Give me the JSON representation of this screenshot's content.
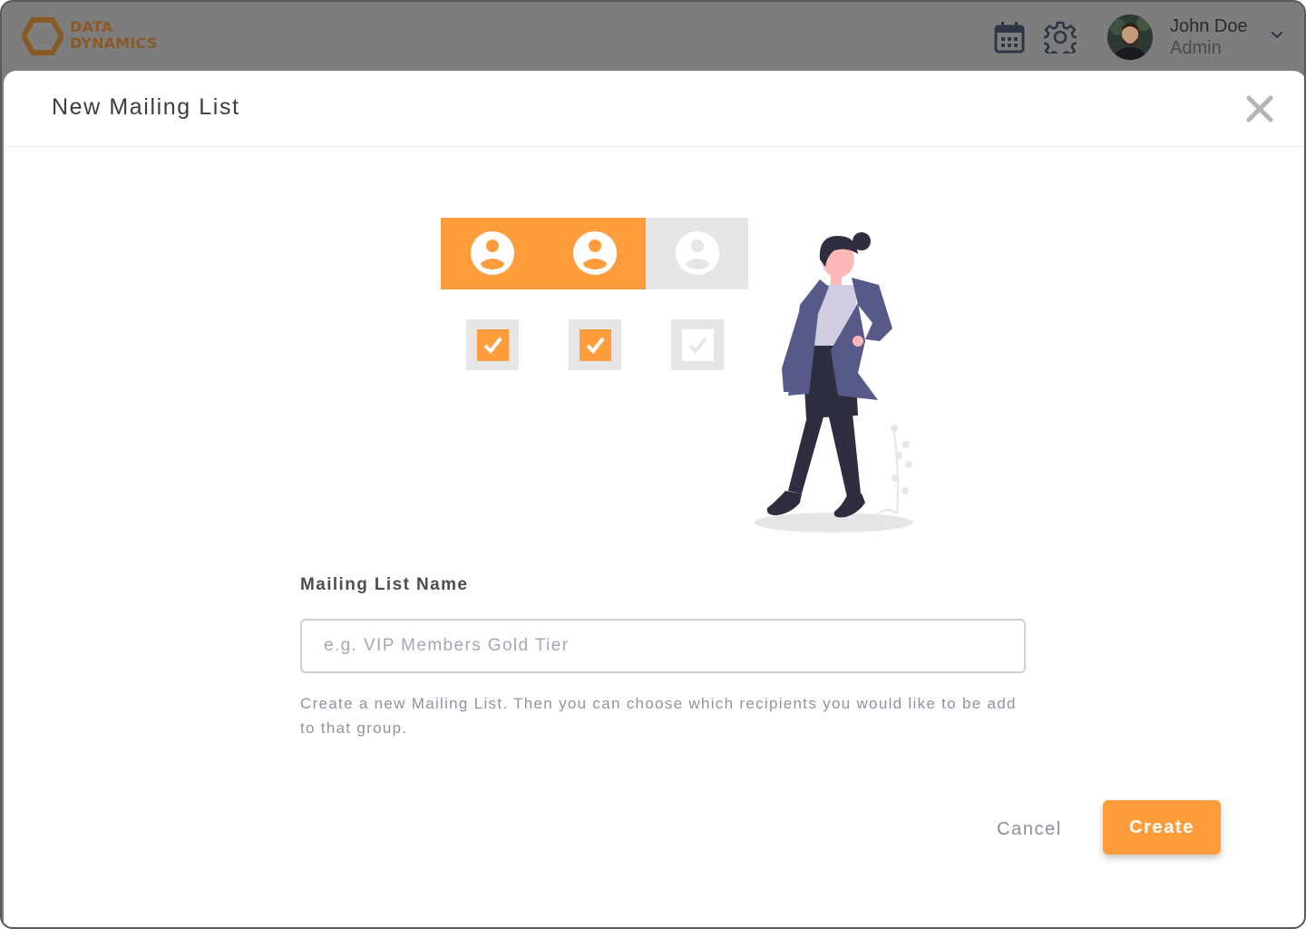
{
  "app": {
    "brand": {
      "line1": "DATA",
      "line2": "DYNAMICS"
    },
    "header_icons": [
      "calendar-icon",
      "gear-icon"
    ],
    "user": {
      "name": "John Doe",
      "role": "Admin"
    }
  },
  "modal": {
    "title": "New Mailing List",
    "close_icon": "close-icon",
    "illustration": {
      "tiles": [
        {
          "icon": "user-icon",
          "selected": true
        },
        {
          "icon": "user-icon",
          "selected": true
        },
        {
          "icon": "user-icon",
          "selected": false
        }
      ]
    },
    "field": {
      "label": "Mailing List Name",
      "value": "",
      "placeholder": "e.g. VIP Members Gold Tier"
    },
    "help_text": "Create a new Mailing List. Then you can choose which recipients you would like to be add to that group.",
    "cancel_label": "Cancel",
    "create_label": "Create"
  },
  "colors": {
    "accent": "#ff9c3b",
    "overlay": "#7d7d7d",
    "figure_jacket": "#575a89",
    "figure_dark": "#2f2e41"
  }
}
